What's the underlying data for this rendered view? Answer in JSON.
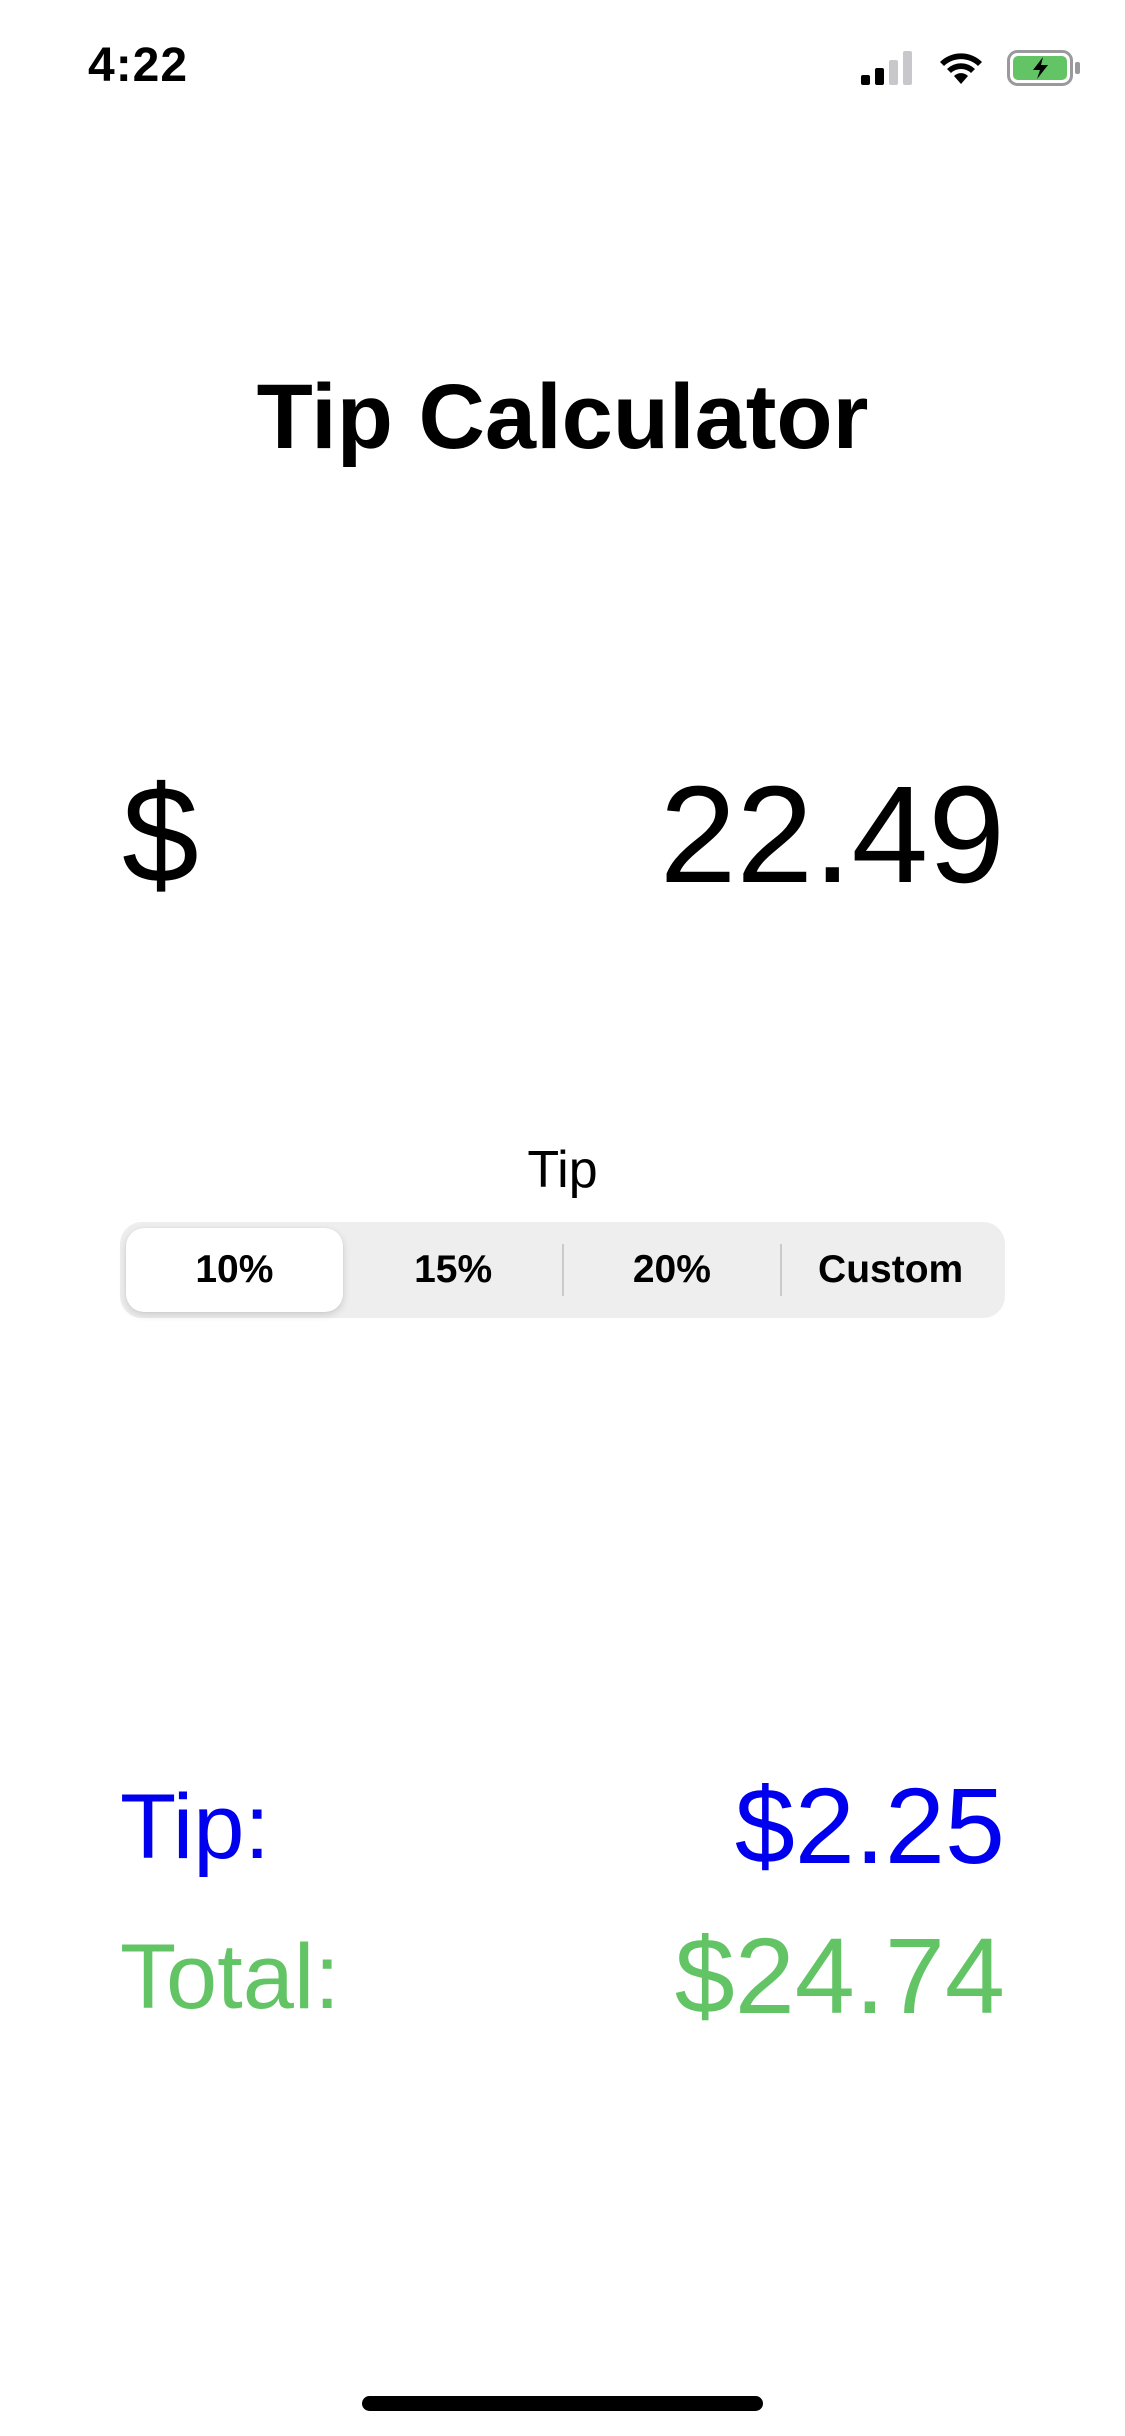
{
  "status_bar": {
    "time": "4:22",
    "icons": [
      "cellular-signal-icon",
      "wifi-icon",
      "battery-charging-icon"
    ],
    "battery_color": "#63c466"
  },
  "title": "Tip Calculator",
  "bill": {
    "currency_symbol": "$",
    "amount": "22.49"
  },
  "tip_section": {
    "label": "Tip",
    "segments": [
      "10%",
      "15%",
      "20%",
      "Custom"
    ],
    "selected_index": 0
  },
  "results": {
    "tip_label": "Tip:",
    "tip_value": "$2.25",
    "total_label": "Total:",
    "total_value": "$24.74",
    "tip_color": "#0000ee",
    "total_color": "#63c466"
  }
}
